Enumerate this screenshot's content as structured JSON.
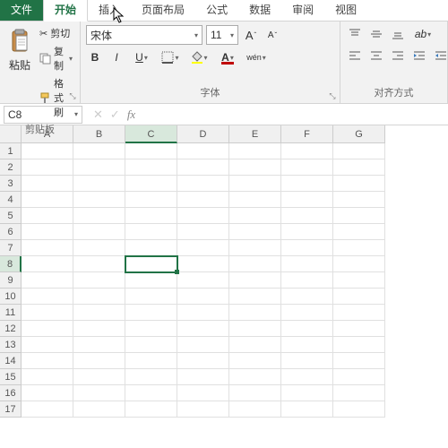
{
  "tabs": {
    "file": "文件",
    "home": "开始",
    "insert": "插入",
    "pagelayout": "页面布局",
    "formulas": "公式",
    "data": "数据",
    "review": "审阅",
    "view": "视图"
  },
  "clipboard": {
    "paste": "粘贴",
    "cut": "剪切",
    "copy": "复制",
    "formatpainter": "格式刷",
    "label": "剪贴板"
  },
  "font": {
    "name": "宋体",
    "size": "11",
    "bold": "B",
    "italic": "I",
    "underline": "U",
    "wen": "wén",
    "label": "字体"
  },
  "align": {
    "label": "对齐方式"
  },
  "namebox": {
    "ref": "C8"
  },
  "fx": {
    "label": "fx"
  },
  "cols": [
    "A",
    "B",
    "C",
    "D",
    "E",
    "F",
    "G"
  ],
  "rows": [
    "1",
    "2",
    "3",
    "4",
    "5",
    "6",
    "7",
    "8",
    "9",
    "10",
    "11",
    "12",
    "13",
    "14",
    "15",
    "16",
    "17"
  ],
  "selected": {
    "col": "C",
    "row": "8"
  }
}
